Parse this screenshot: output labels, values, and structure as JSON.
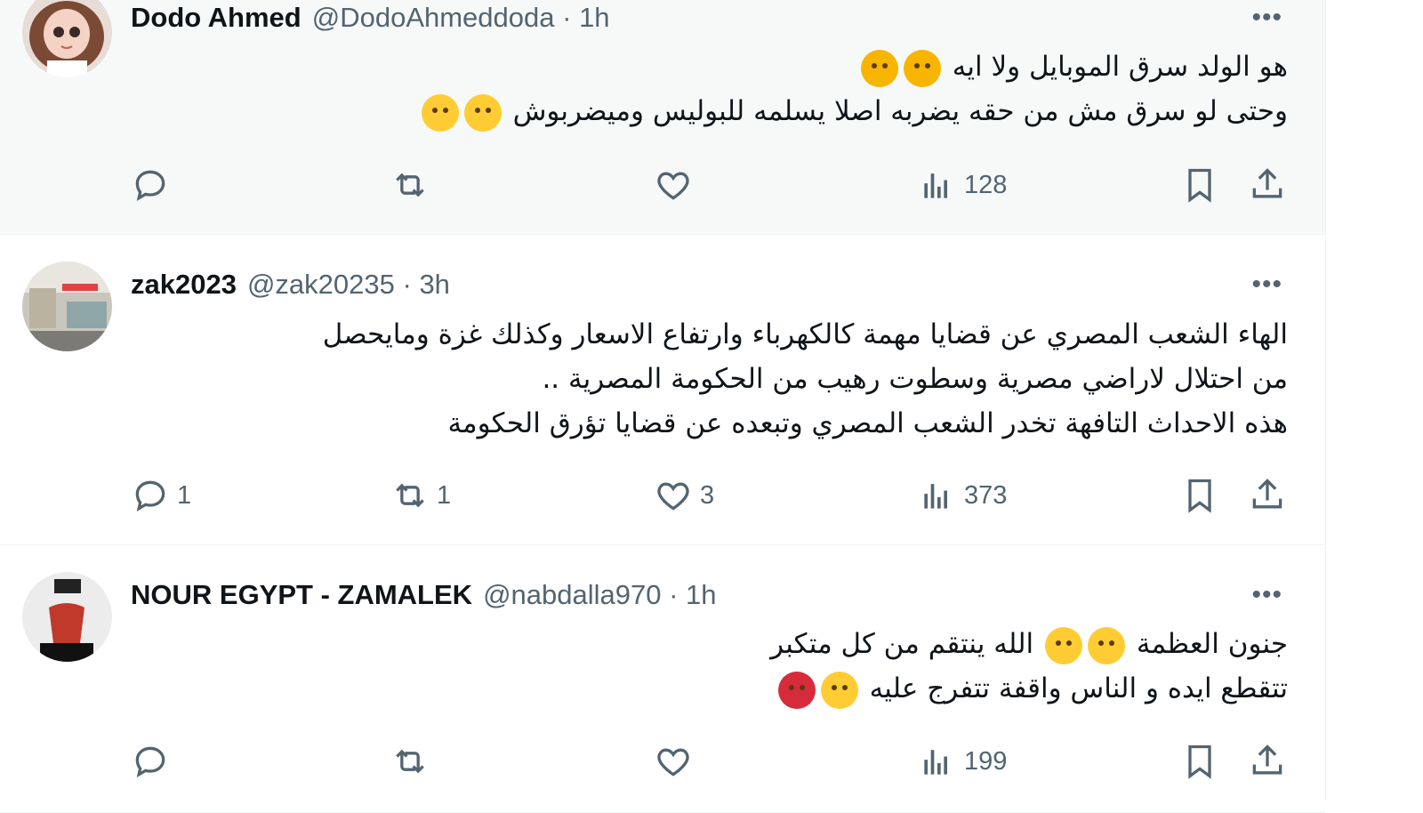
{
  "tweets": [
    {
      "name": "Dodo Ahmed",
      "handle": "@DodoAhmeddoda",
      "time": "1h",
      "more": "•••",
      "lines": [
        {
          "text": "هو الولد سرق الموبايل ولا ايه",
          "emojis": [
            "thinking-face",
            "thinking-face"
          ]
        },
        {
          "text": "وحتى لو سرق مش من حقه يضربه اصلا يسلمه للبوليس وميضربوش",
          "emojis": [
            "unamused-face",
            "face-with-rolling-eyes"
          ]
        }
      ],
      "stats": {
        "replies": "",
        "reposts": "",
        "likes": "",
        "views": "128"
      }
    },
    {
      "name": "zak2023",
      "handle": "@zak20235",
      "time": "3h",
      "more": "•••",
      "lines": [
        {
          "text": "الهاء الشعب المصري عن قضايا مهمة كالكهرباء وارتفاع الاسعار وكذلك غزة ومايحصل",
          "emojis": []
        },
        {
          "text": "من احتلال لاراضي مصرية وسطوت رهيب من الحكومة المصرية ..",
          "emojis": []
        },
        {
          "text": "هذه الاحداث التافهة تخدر الشعب المصري وتبعده عن قضايا تؤرق الحكومة",
          "emojis": []
        }
      ],
      "stats": {
        "replies": "1",
        "reposts": "1",
        "likes": "3",
        "views": "373"
      }
    },
    {
      "name": "NOUR EGYPT - ZAMALEK",
      "handle": "@nabdalla970",
      "time": "1h",
      "more": "•••",
      "lines": [
        {
          "text_a": "جنون العظمة",
          "text_b": "الله ينتقم من كل متكبر",
          "emojis": [
            "smirking-face",
            "slightly-frowning-face"
          ]
        },
        {
          "text": "تتقطع ايده و الناس واقفة تتفرج عليه",
          "emojis": [
            "smirking-face",
            "face-with-symbols-on-mouth"
          ]
        }
      ],
      "stats": {
        "replies": "",
        "reposts": "",
        "likes": "",
        "views": "199"
      }
    }
  ]
}
